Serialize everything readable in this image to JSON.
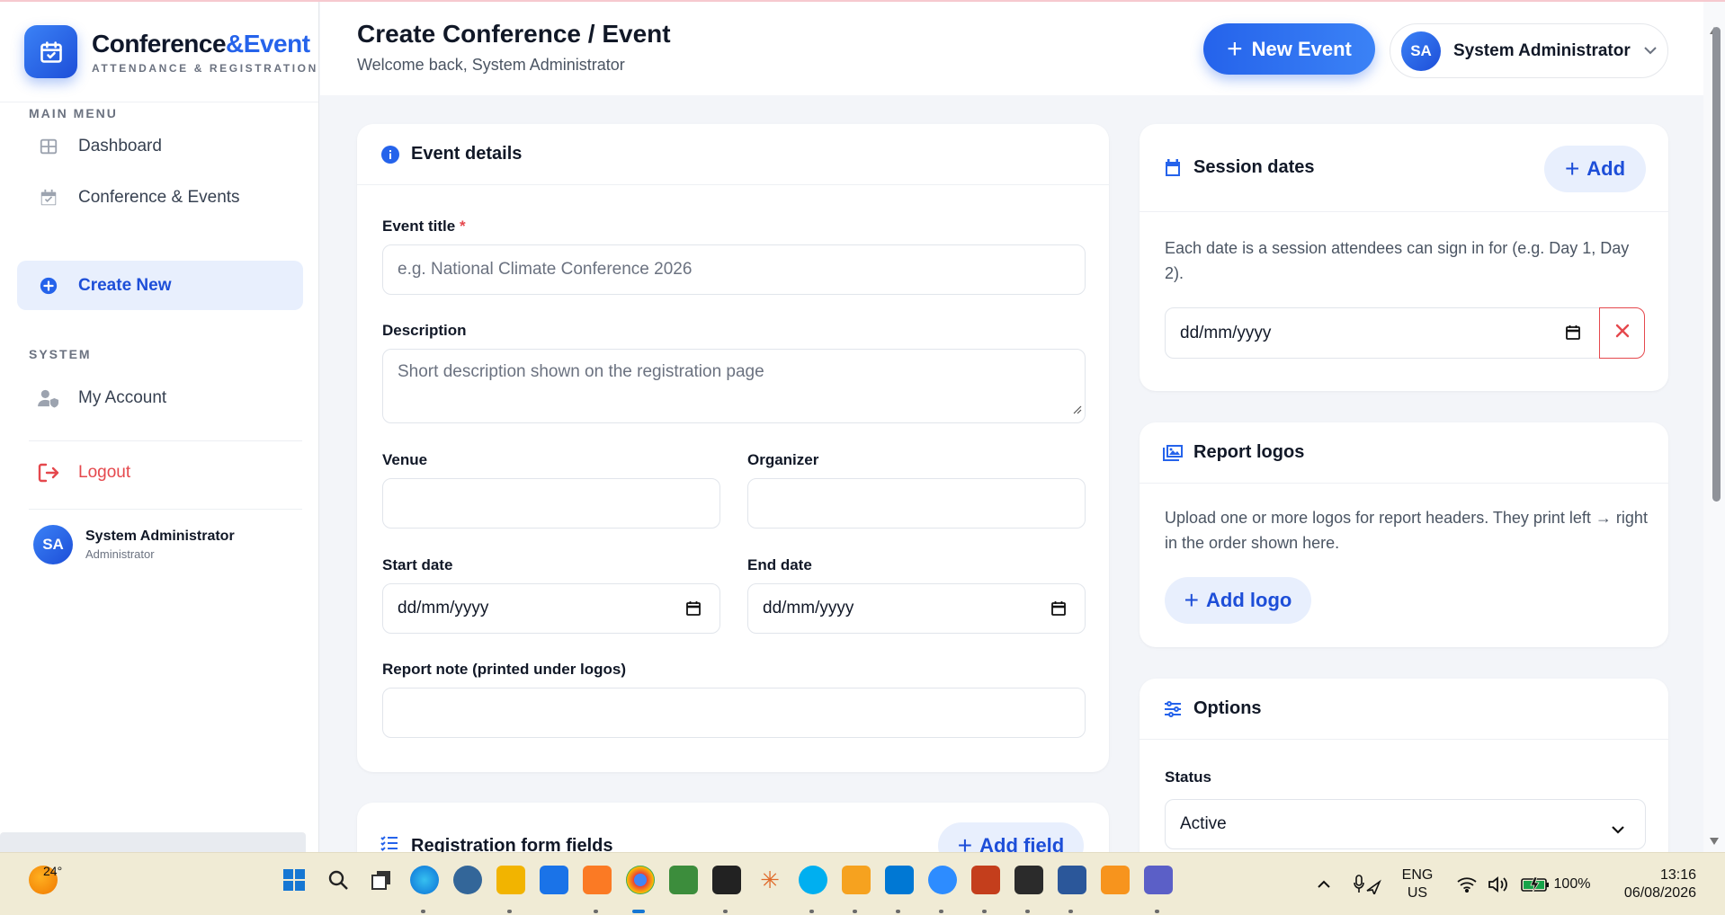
{
  "brand": {
    "name_main": "Conference",
    "name_accent": "&Event",
    "tagline": "ATTENDANCE & REGISTRATION"
  },
  "sidebar": {
    "section_main": "MAIN MENU",
    "section_system": "SYSTEM",
    "items": [
      {
        "label": "Dashboard",
        "icon": "grid-icon"
      },
      {
        "label": "Conference & Events",
        "icon": "calendar-check-icon"
      },
      {
        "label": "Create New",
        "icon": "plus-circle-icon",
        "active": true
      },
      {
        "label": "My Account",
        "icon": "user-shield-icon"
      },
      {
        "label": "Logout",
        "icon": "logout-icon"
      }
    ],
    "user": {
      "initials": "SA",
      "name": "System Administrator",
      "role": "Administrator"
    }
  },
  "header": {
    "title": "Create Conference / Event",
    "subtitle": "Welcome back, System Administrator",
    "new_event_label": "New Event",
    "user_initials": "SA",
    "user_name": "System Administrator"
  },
  "event_details": {
    "heading": "Event details",
    "title_label": "Event title",
    "title_required_mark": "*",
    "title_placeholder": "e.g. National Climate Conference 2026",
    "description_label": "Description",
    "description_placeholder": "Short description shown on the registration page",
    "venue_label": "Venue",
    "venue_value": "",
    "organizer_label": "Organizer",
    "organizer_value": "",
    "start_date_label": "Start date",
    "start_date_value": "dd/mm/yyyy",
    "end_date_label": "End date",
    "end_date_value": "dd/mm/yyyy",
    "report_note_label": "Report note (printed under logos)",
    "report_note_value": ""
  },
  "registration_fields": {
    "heading": "Registration form fields",
    "add_label": "Add field"
  },
  "session_dates": {
    "heading": "Session dates",
    "add_label": "Add",
    "help": "Each date is a session attendees can sign in for (e.g. Day 1, Day 2).",
    "date_value": "dd/mm/yyyy"
  },
  "report_logos": {
    "heading": "Report logos",
    "help": "Upload one or more logos for report headers. They print left → right in the order shown here.",
    "add_label": "Add logo"
  },
  "options": {
    "heading": "Options",
    "status_label": "Status",
    "status_value": "Active"
  },
  "taskbar": {
    "weather_temp": "24°",
    "language_top": "ENG",
    "language_bottom": "US",
    "battery": "100%",
    "time": "13:16",
    "date": "06/08/2026"
  },
  "colors": {
    "primary": "#2563eb",
    "primary_soft": "#e8effd",
    "danger": "#e5484d",
    "background": "#f3f5f9"
  }
}
